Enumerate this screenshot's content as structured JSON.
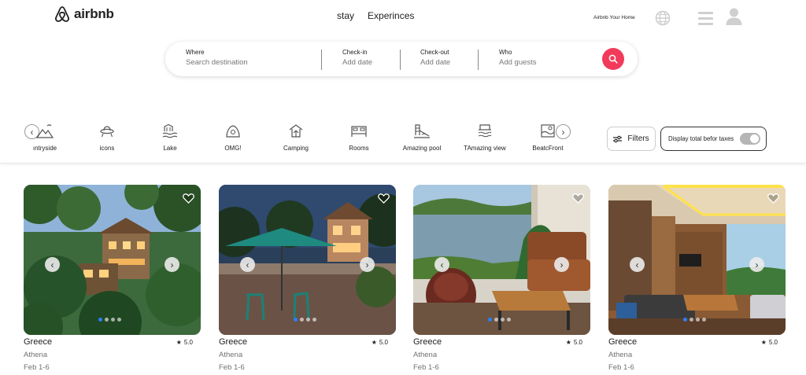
{
  "header": {
    "brand": "airbnb",
    "nav": [
      "stay",
      "Experinces"
    ],
    "host_link": "Airbnb Your Home",
    "icons": [
      "airbnb-logo-icon",
      "globe-icon",
      "hamburger-menu-icon",
      "user-icon"
    ]
  },
  "search": {
    "where": {
      "label": "Where",
      "placeholder": "Search destination"
    },
    "checkin": {
      "label": "Check-in",
      "placeholder": "Add date"
    },
    "checkout": {
      "label": "Check-out",
      "placeholder": "Add date"
    },
    "who": {
      "label": "Who",
      "placeholder": "Add guests"
    },
    "button_icon": "search-icon",
    "accent": "#f23a5a"
  },
  "categories": [
    {
      "label": "ıntryside",
      "icon": "countryside-icon"
    },
    {
      "label": "icons",
      "icon": "ufo-icon"
    },
    {
      "label": "Lake",
      "icon": "lake-icon"
    },
    {
      "label": "OMG!",
      "icon": "omg-house-icon"
    },
    {
      "label": "Camping",
      "icon": "camping-icon"
    },
    {
      "label": "Rooms",
      "icon": "bed-icon"
    },
    {
      "label": "Amazing pool",
      "icon": "pool-icon"
    },
    {
      "label": "TAmazing view",
      "icon": "view-icon"
    },
    {
      "label": "BeatcFront",
      "icon": "beachfront-icon"
    }
  ],
  "filters": {
    "label": "Filters",
    "icon": "sliders-icon"
  },
  "taxes_toggle": {
    "label": "Display total befor taxes",
    "on": false
  },
  "listings": [
    {
      "title": "Greece",
      "rating": "5.0",
      "location": "Athena",
      "dates": "Feb 1-6",
      "active_photo": 0,
      "photo_count": 4
    },
    {
      "title": "Greece",
      "rating": "5.0",
      "location": "Athena",
      "dates": "Feb 1-6",
      "active_photo": 0,
      "photo_count": 4
    },
    {
      "title": "Greece",
      "rating": "5.0",
      "location": "Athena",
      "dates": "Feb 1-6",
      "active_photo": 0,
      "photo_count": 4
    },
    {
      "title": "Greece",
      "rating": "5.0",
      "location": "Athena",
      "dates": "Feb 1-6",
      "active_photo": 0,
      "photo_count": 4
    }
  ]
}
